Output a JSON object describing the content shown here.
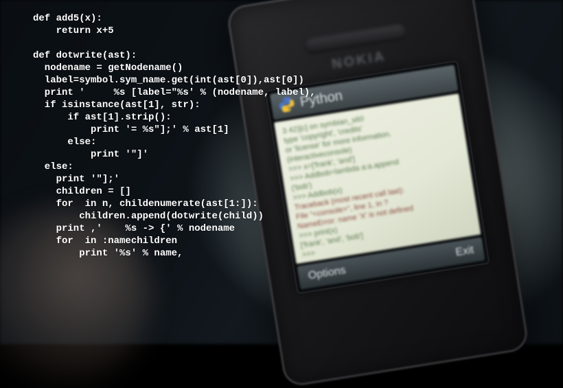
{
  "code_overlay": "def add5(x):\n    return x+5\n\ndef dotwrite(ast):\n  nodename = getNodename()\n  label=symbol.sym_name.get(int(ast[0]),ast[0])\n  print '     %s [label=\"%s' % (nodename, label),\n  if isinstance(ast[1], str):\n      if ast[1].strip():\n          print '= %s\"];' % ast[1]\n      else:\n          print '\"]'\n  else:\n    print '\"];'\n    children = []\n    for  in n, childenumerate(ast[1:]):\n        children.append(dotwrite(child))\n    print ,'    %s -> {' % nodename\n    for  in :namechildren\n        print '%s' % name,",
  "phone": {
    "brand": "NOKIA",
    "title": "Python",
    "softkeys": {
      "left": "Options",
      "right": "Exit"
    },
    "screen_lines": [
      {
        "t": "3 42)[c] on symbian_s60",
        "c": "line"
      },
      {
        "t": "type 'copyright', 'credits'",
        "c": "line"
      },
      {
        "t": "or 'license' for more information.",
        "c": "line"
      },
      {
        "t": "(interactiveconsole)",
        "c": "line"
      },
      {
        "t": ">>> x=['frank', 'and']",
        "c": "line"
      },
      {
        "t": ">>> Addbob=lambda a:a.append",
        "c": "line"
      },
      {
        "t": "('bob')",
        "c": "line"
      },
      {
        "t": ">>> Addbob(x)",
        "c": "line"
      },
      {
        "t": "Traceback (most recent call last):",
        "c": "line err"
      },
      {
        "t": "  File \"<console>\", line 1, in ?",
        "c": "line err"
      },
      {
        "t": "NameError: name 'X' is not defined",
        "c": "line err"
      },
      {
        "t": ">>> print(x)",
        "c": "line"
      },
      {
        "t": "['frank', 'and', 'bob']",
        "c": "line"
      },
      {
        "t": ">>>",
        "c": "line"
      }
    ]
  }
}
